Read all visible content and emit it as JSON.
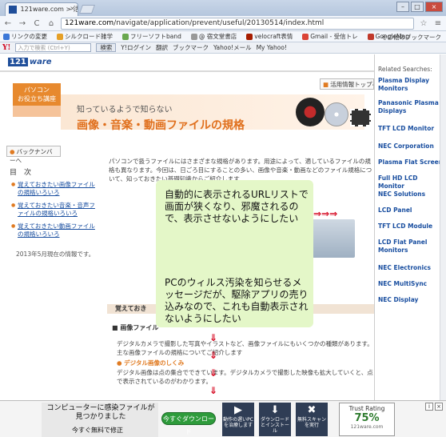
{
  "browser": {
    "tab_title": "121ware.com > 活用情",
    "tab_close": "×",
    "url_domain": "121ware.com",
    "url_path": "/navigate/application/prevent/useful/20130514/index.html",
    "nav_back": "←",
    "nav_forward": "→",
    "nav_reload": "C",
    "nav_home": "⌂",
    "star": "☆",
    "menu": "≡",
    "win_min": "–",
    "win_max": "□",
    "win_close": "×"
  },
  "bookmarks": {
    "items": [
      {
        "label": "リンクの変更",
        "color": "#3c78d8"
      },
      {
        "label": "シルクロード雑学",
        "color": "#e5a028"
      },
      {
        "label": "フリーソフトband",
        "color": "#6aa84f"
      },
      {
        "label": "@ 宿文堂書店",
        "color": "#999999"
      },
      {
        "label": "velocraft表情",
        "color": "#a61c00"
      },
      {
        "label": "Gmail - 受信トレ",
        "color": "#db4437"
      },
      {
        "label": "GoogleMap",
        "color": "#c0392b"
      }
    ],
    "other": "その他のブックマーク"
  },
  "yahoobar": {
    "logo": "Y!",
    "search_placeholder": "入力で検索 (Ctrl+Y)",
    "search_btn": "検索",
    "login": "Y!ログイン",
    "translate": "翻訳",
    "bookmark": "ブックマーク",
    "mail": "Yahoo!メール",
    "myyahoo": "My Yahoo!"
  },
  "page": {
    "logo_mark": "121",
    "logo_text": "ware",
    "badge_top": "パソコン",
    "badge_bottom": "お役立ち講座",
    "link_top": "活用情報トップへ",
    "subtitle": "知っているようで知らない",
    "title": "画像・音楽・動画ファイルの規格",
    "back_btn": "バックナンバーへ",
    "toc_title": "目　次",
    "toc": [
      "覚えておきたい画像ファイルの規格いろいろ",
      "覚えておきたい音楽・音声ファイルの規格いろいろ",
      "覚えておきたい動画ファイルの規格いろいろ"
    ],
    "date": "2013年5月現在の情報です。",
    "intro": "パソコンで扱うファイルにはさまざまな規格があります。用途によって、適しているファイルの規格も異なります。今回は、日ごろ目にすることの多い、画像や音楽・動画などのファイル規格について、知っておきたい基礎知識からご紹介します",
    "section": "覚えておき",
    "sub1": "■ 画像ファイル",
    "body1": "デジタルカメラで撮影した写真やイラストなど、画像ファイルにもいくつかの種類があります。主な画像ファイルの規格についてご紹介します",
    "sub2": "● デジタル画像のしくみ",
    "body2": "デジタル画像は点の集合でできています。デジタルカメラで撮影した映像も拡大していくと、点で表示されているのがわかります。"
  },
  "annotation": {
    "note1": "自動的に表示されるURLリストで画面が狭くなり、邪魔されるので、表示させないようにしたい",
    "note2": "PCのウィルス汚染を知らせるメッセージだが、駆除アプリの売り込みなので、これも自動表示されないようにしたい",
    "arrow_h": "⇒⇒⇒",
    "arrow_v": "⇓"
  },
  "sidebar": {
    "title": "Related Searches:",
    "items": [
      "Plasma Display Monitors",
      "Panasonic Plasma Displays",
      "TFT LCD Monitor",
      "NEC Corporation",
      "Plasma Flat Screen",
      "Full HD LCD Monitor",
      "NEC Solutions",
      "LCD Panel",
      "TFT LCD Module",
      "LCD Flat Panel Monitors",
      "NEC Electronics",
      "NEC MultiSync",
      "NEC Display"
    ]
  },
  "ad": {
    "message": "コンピューターに感染ファイルが見つかりました",
    "sub": "今すぐ無料で修正",
    "button": "今すぐダウンロード",
    "tiles": [
      {
        "icon": "▶",
        "label": "動作の遅いPCを治療します"
      },
      {
        "icon": "⬇",
        "label": "ダウンロードとインストール"
      },
      {
        "icon": "✖",
        "label": "無料スキャンを実行"
      }
    ],
    "trust_title": "Trust Rating",
    "trust_value": "75%",
    "trust_site": "121ware.com",
    "close": "×",
    "info": "i"
  }
}
